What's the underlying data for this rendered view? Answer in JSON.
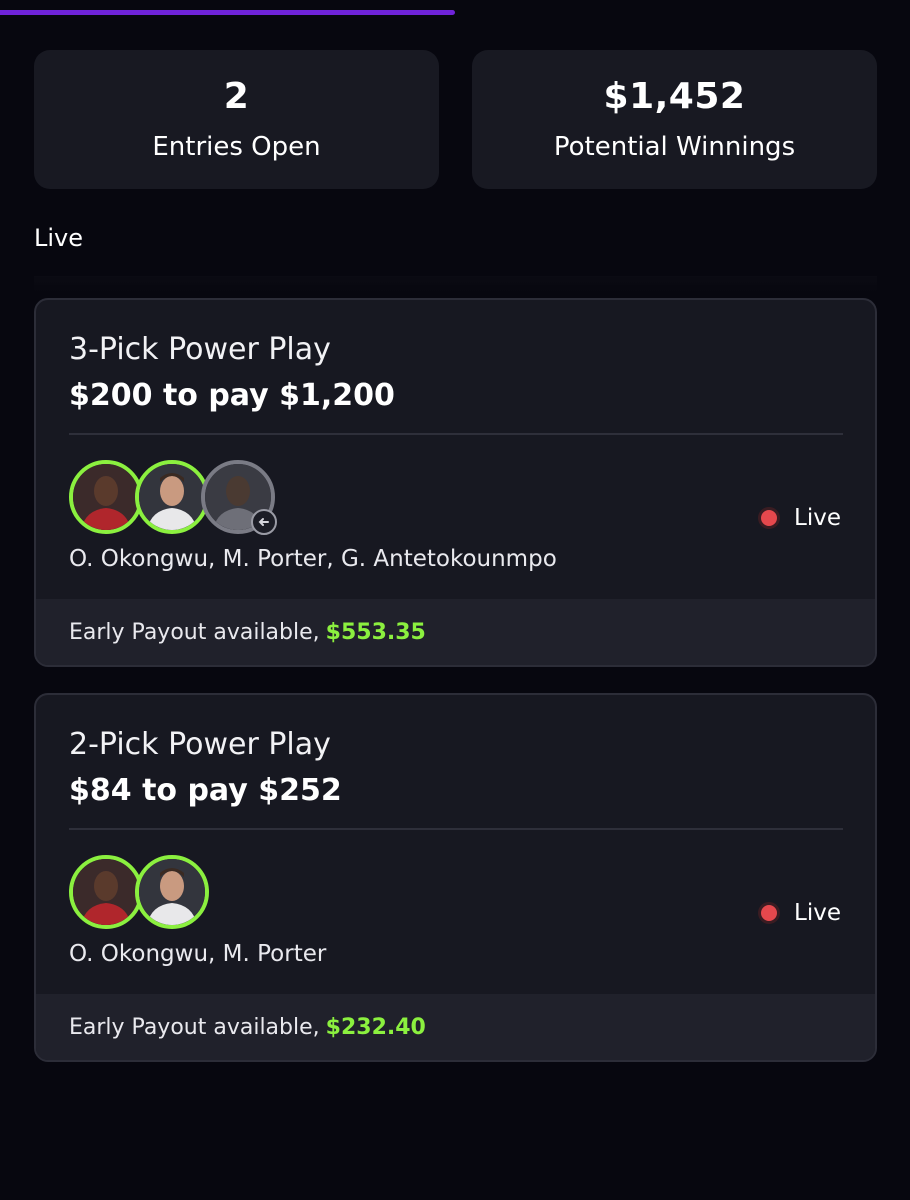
{
  "progress": {
    "fraction": 0.5
  },
  "stats": {
    "entries_open_value": "2",
    "entries_open_label": "Entries Open",
    "winnings_value": "$1,452",
    "winnings_label": "Potential Winnings"
  },
  "section": {
    "title": "Live"
  },
  "entries": [
    {
      "type": "3-Pick Power Play",
      "stake": "$200 to pay $1,200",
      "players": "O. Okongwu, M. Porter, G. Antetokounmpo",
      "status": "Live",
      "payout_label": "Early Payout available,",
      "payout_amount": "$553.35"
    },
    {
      "type": "2-Pick Power Play",
      "stake": "$84 to pay $252",
      "players": "O. Okongwu, M. Porter",
      "status": "Live",
      "payout_label": "Early Payout available,",
      "payout_amount": "$232.40"
    }
  ],
  "colors": {
    "accent_purple": "#6f23d9",
    "hit_green": "#8bf03f",
    "live_red": "#e5484d"
  }
}
